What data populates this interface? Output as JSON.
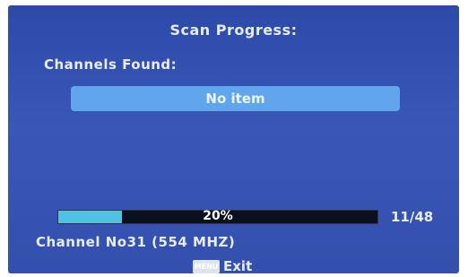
{
  "header": {
    "title": "Scan Progress:"
  },
  "channels": {
    "label": "Channels Found:",
    "items": [
      "No item"
    ]
  },
  "scan": {
    "progress_fraction": 0.2,
    "progress_text": "20%",
    "count": "11/48",
    "channel_info": "Channel No31 (554 MHZ)"
  },
  "footer": {
    "key_label": "MENU",
    "exit_label": "Exit"
  },
  "colors": {
    "background": "#3550ae",
    "list_item": "#5fa6ec",
    "progress_fill": "#4fc2e4",
    "progress_track": "#0b1020",
    "text": "#e8ecf6"
  }
}
